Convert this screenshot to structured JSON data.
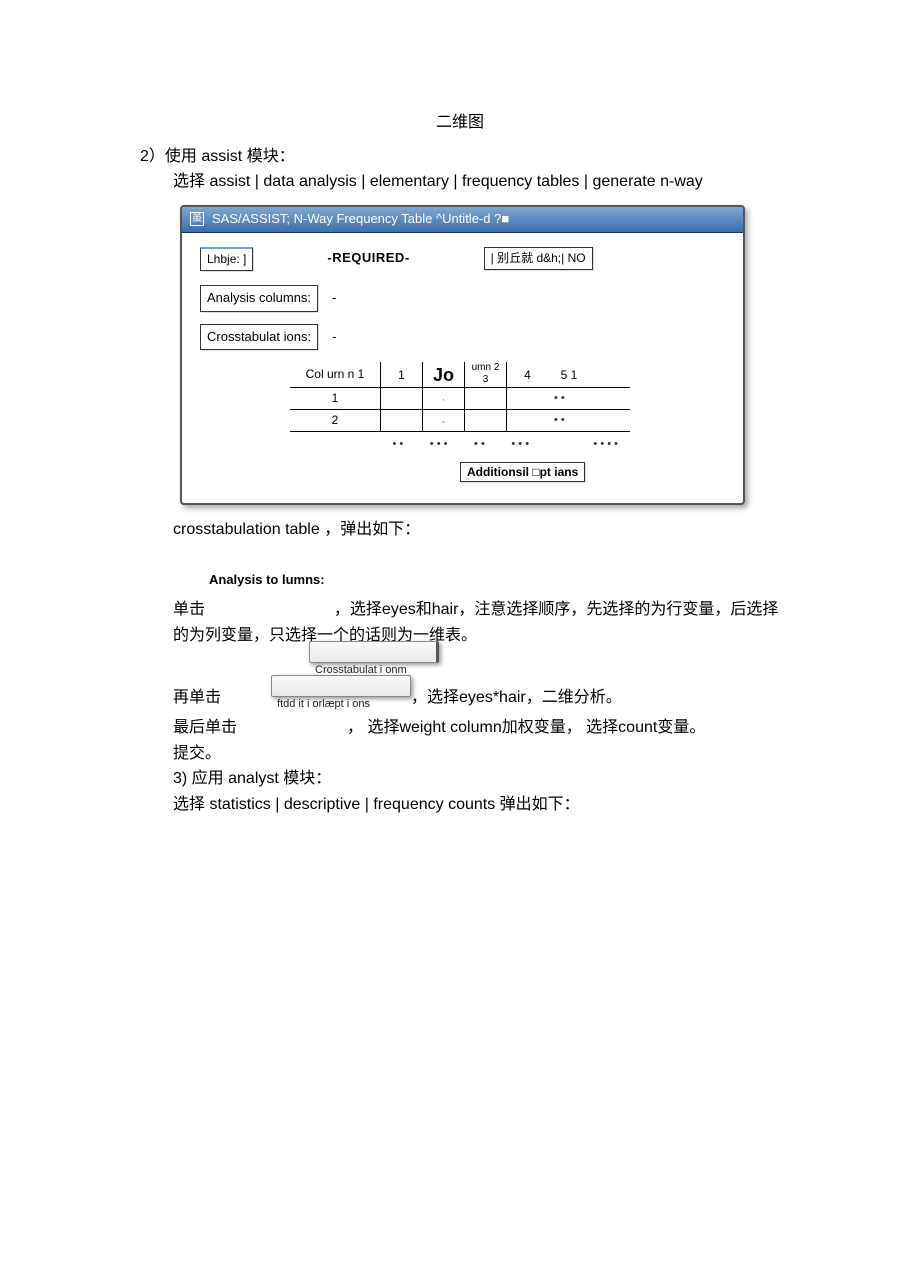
{
  "title": "二维图",
  "step2_line": "2）使用  assist 模块：",
  "step2_sel": "选择  assist | data analysis | elementary | frequency tables | generate n-way",
  "sas_window": {
    "title": "SAS/ASSIST; N-Way Frequency Table ^Untitle-d ?■",
    "icon": "虽",
    "lhbje_chip": "Lhbje:   ]",
    "required": "-REQUIRED-",
    "right_chip": "| 别丘就  d&h;| NO",
    "analysis_columns_label": "Analysis columns:",
    "crosstab_label": "Crosstabulat ions:",
    "dash": "-",
    "grid": {
      "col_label": "Col urn n 1",
      "headers": [
        "1",
        "Jo",
        "umn 2\n3",
        "4",
        "5 1"
      ],
      "rows": [
        "1",
        "2"
      ],
      "dots_row": [
        "• •",
        "• • •",
        "• •",
        "• • •",
        "",
        "• • • •"
      ]
    },
    "add_options": "Additionsil □pt ians"
  },
  "crosstab_popup": "crosstabulation table ，弹出如下：",
  "analysis_to_lumns": "Analysis to lumns:",
  "para1_a": "单击",
  "para1_b": "，选择eyes和hair，注意选择顺序，先选择的为行变量，后选择",
  "para1_c": "的为列变量，只选择一个的话则为一维表。",
  "btn1_caption": "Crosstabulat i onm",
  "para2_a": "再单击",
  "para2_b": "，选择eyes*hair，二维分析。",
  "btn2_caption": "ftdd it i orlæpt i ons",
  "para3_a": "最后单击",
  "para3_b": "， 选择weight column加权变量， 选择count变量。",
  "submit_line": "提交。",
  "step3_line": "3) 应用  analyst 模块：",
  "step3_sel": "选择  statistics | descriptive | frequency counts 弹出如下："
}
